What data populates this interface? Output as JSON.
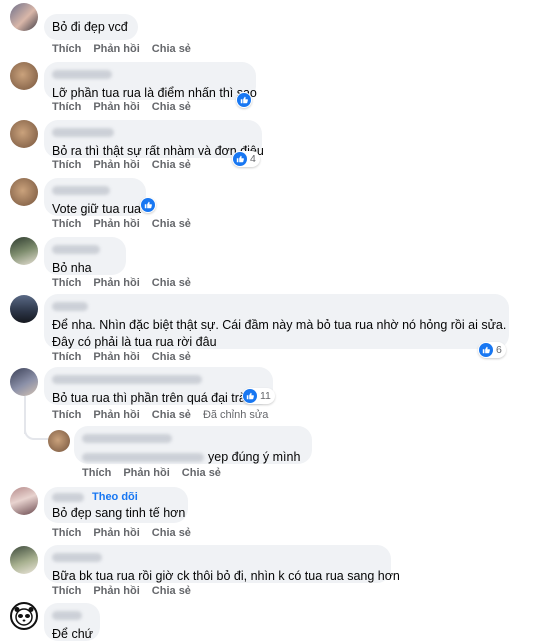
{
  "actions": {
    "like": "Thích",
    "reply": "Phản hồi",
    "share": "Chia sẻ",
    "edited": "Đã chỉnh sửa"
  },
  "colors": {
    "bubble": "#f0f2f5",
    "meta_text": "#65676b",
    "like_blue": "#1877f2"
  },
  "comments": [
    {
      "text": "Bỏ đi đẹp vcđ",
      "likes": null
    },
    {
      "text": "Lỡ phần tua rua là điểm nhấn thì sao",
      "likes": ""
    },
    {
      "text": "Bỏ ra thì thật sự rất nhàm và đơn điệu",
      "likes": "4"
    },
    {
      "text": "Vote giữ tua rua",
      "likes": ""
    },
    {
      "text": "Bỏ nha",
      "likes": null
    },
    {
      "text": "Để nha. Nhìn đặc biệt thật sự. Cái đầm này mà bỏ tua rua nhờ nó hỏng rồi ai sửa.",
      "text2": "Đây có phải là tua rua rời đâu",
      "likes": "6"
    },
    {
      "text": "Bỏ tua rua thì phần trên quá đại trà",
      "likes": "11"
    },
    {
      "text": "yep đúng ý mình",
      "likes": null
    },
    {
      "text": "Bỏ đẹp sang tinh tế hơn",
      "follow": "Theo dõi",
      "likes": null
    },
    {
      "text": "Bữa bk tua rua rồi giờ ck thôi bỏ đi, nhìn k có tua rua sang hơn",
      "likes": null
    },
    {
      "text": "Để chứ",
      "likes": null
    }
  ]
}
